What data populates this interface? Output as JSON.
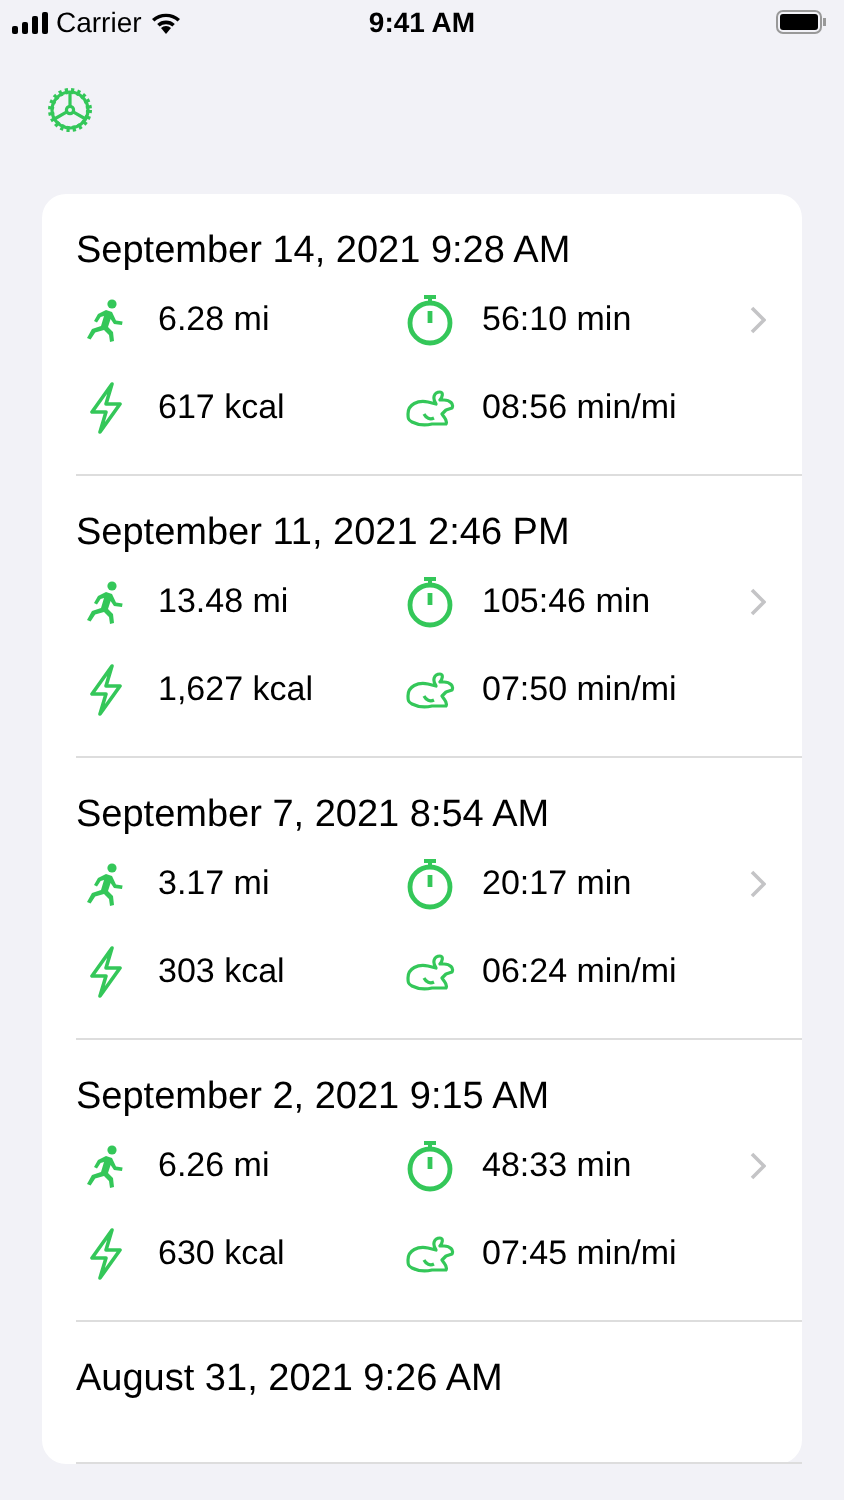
{
  "status_bar": {
    "carrier": "Carrier",
    "time": "9:41 AM"
  },
  "workouts": [
    {
      "date": "September 14, 2021 9:28 AM",
      "distance": "6.28 mi",
      "duration": "56:10 min",
      "calories": "617 kcal",
      "pace": "08:56 min/mi"
    },
    {
      "date": "September 11, 2021 2:46 PM",
      "distance": "13.48 mi",
      "duration": "105:46 min",
      "calories": "1,627 kcal",
      "pace": "07:50 min/mi"
    },
    {
      "date": "September 7, 2021 8:54 AM",
      "distance": "3.17 mi",
      "duration": "20:17 min",
      "calories": "303 kcal",
      "pace": "06:24 min/mi"
    },
    {
      "date": "September 2, 2021 9:15 AM",
      "distance": "6.26 mi",
      "duration": "48:33 min",
      "calories": "630 kcal",
      "pace": "07:45 min/mi"
    },
    {
      "date": "August 31, 2021 9:26 AM"
    }
  ]
}
